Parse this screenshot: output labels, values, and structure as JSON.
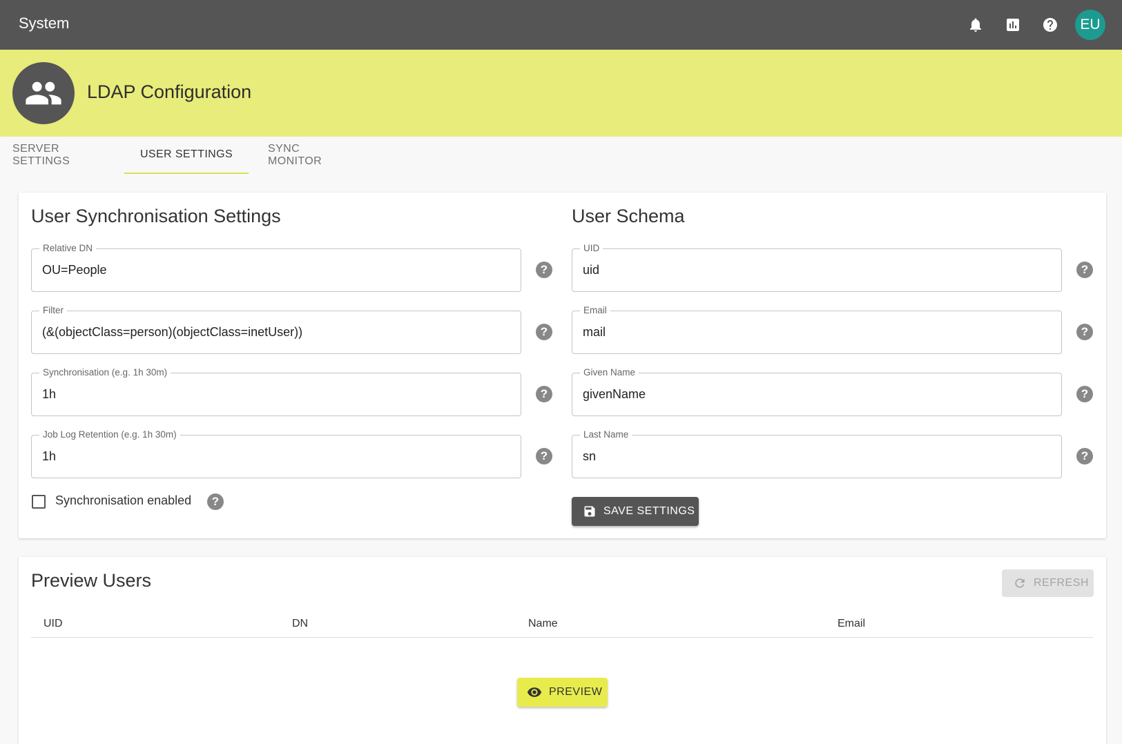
{
  "app": {
    "title": "System"
  },
  "topbar": {
    "icons": [
      "bell-icon",
      "chart-icon",
      "help-icon"
    ],
    "avatar_initials": "EU",
    "avatar_color": "#1c9b90"
  },
  "banner": {
    "title": "LDAP Configuration",
    "icon": "people-icon",
    "color": "#e7ec7a"
  },
  "tabs": [
    {
      "label": "SERVER SETTINGS",
      "active": false
    },
    {
      "label": "USER SETTINGS",
      "active": true
    },
    {
      "label": "SYNC MONITOR",
      "active": false
    }
  ],
  "sync_settings": {
    "title": "User Synchronisation Settings",
    "fields": [
      {
        "label": "Relative DN",
        "value": "OU=People"
      },
      {
        "label": "Filter",
        "value": "(&(objectClass=person)(objectClass=inetUser))"
      },
      {
        "label": "Synchronisation (e.g. 1h 30m)",
        "value": "1h"
      },
      {
        "label": "Job Log Retention (e.g. 1h 30m)",
        "value": "1h"
      }
    ],
    "checkbox": {
      "label": "Synchronisation enabled",
      "checked": false
    }
  },
  "user_schema": {
    "title": "User Schema",
    "fields": [
      {
        "label": "UID",
        "value": "uid"
      },
      {
        "label": "Email",
        "value": "mail"
      },
      {
        "label": "Given Name",
        "value": "givenName"
      },
      {
        "label": "Last Name",
        "value": "sn"
      }
    ],
    "save_label": "SAVE SETTINGS"
  },
  "preview": {
    "title": "Preview Users",
    "refresh_label": "REFRESH",
    "columns": [
      "UID",
      "DN",
      "Name",
      "Email"
    ],
    "preview_label": "PREVIEW"
  }
}
